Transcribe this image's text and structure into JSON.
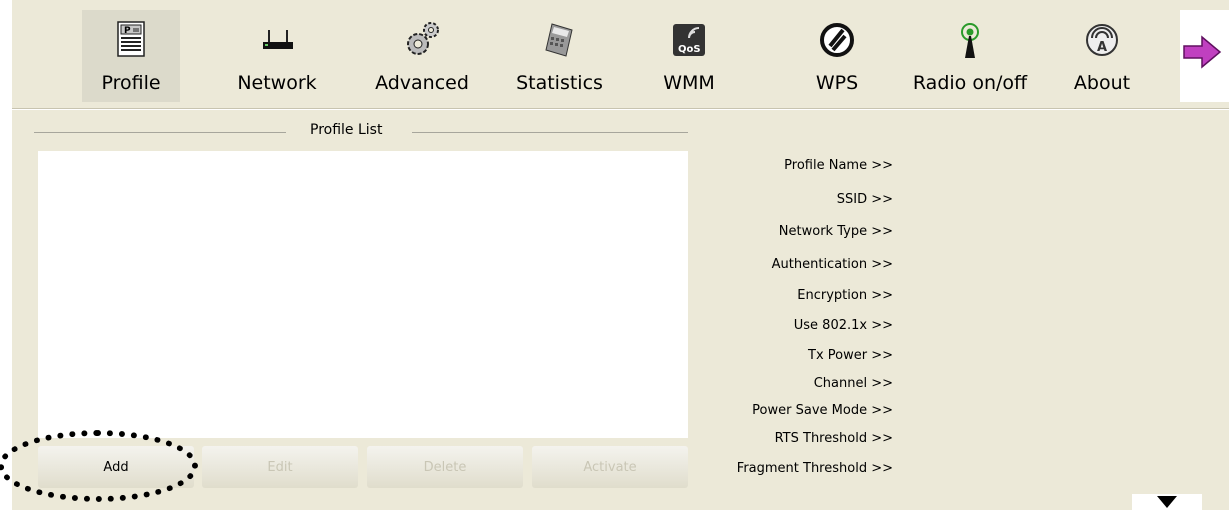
{
  "toolbar": {
    "items": [
      {
        "label": "Profile",
        "icon": "profile-icon"
      },
      {
        "label": "Network",
        "icon": "network-router-icon"
      },
      {
        "label": "Advanced",
        "icon": "advanced-gears-icon"
      },
      {
        "label": "Statistics",
        "icon": "statistics-calculator-icon"
      },
      {
        "label": "WMM",
        "icon": "wmm-qos-icon"
      },
      {
        "label": "WPS",
        "icon": "wps-icon"
      },
      {
        "label": "Radio on/off",
        "icon": "radio-antenna-icon"
      },
      {
        "label": "About",
        "icon": "about-icon"
      }
    ],
    "next_icon": "next-arrow-icon"
  },
  "profile_list": {
    "title": "Profile List"
  },
  "buttons": {
    "add": "Add",
    "edit": "Edit",
    "delete": "Delete",
    "activate": "Activate"
  },
  "details": {
    "profile_name": "Profile Name >>",
    "ssid": "SSID >>",
    "network_type": "Network Type >>",
    "authentication": "Authentication >>",
    "encryption": "Encryption >>",
    "use_8021x": "Use 802.1x >>",
    "tx_power": "Tx Power >>",
    "channel": "Channel >>",
    "power_save_mode": "Power Save Mode >>",
    "rts_threshold": "RTS Threshold >>",
    "fragment_threshold": "Fragment Threshold >>"
  },
  "colors": {
    "background": "#ece9d8",
    "list_background": "#ffffff",
    "disabled_text": "#c9c6b5"
  }
}
